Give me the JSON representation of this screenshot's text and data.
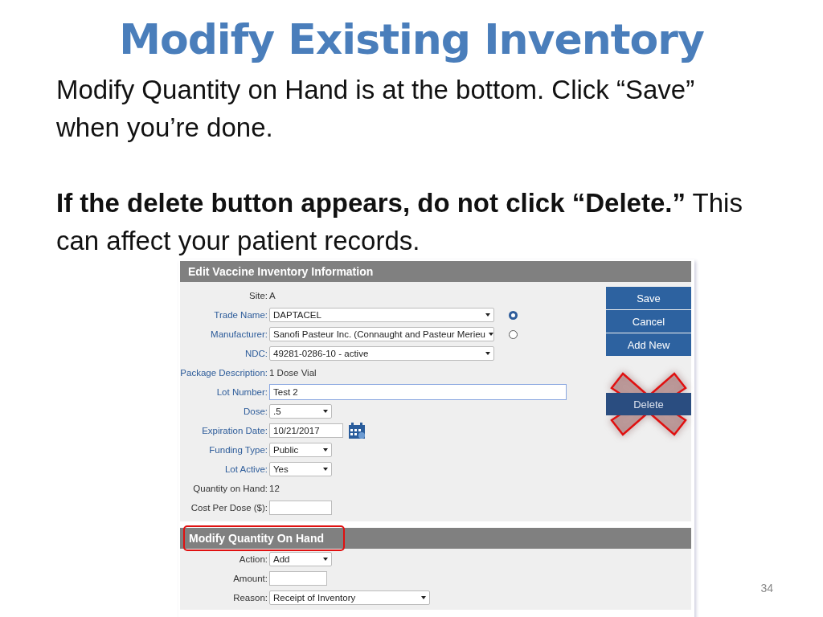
{
  "title": "Modify Existing Inventory",
  "paragraphs": [
    {
      "text": "Modify Quantity on Hand is at the bottom. Click “Save” when you’re done.",
      "bold": false
    },
    {
      "text": "**If the delete button appears, do not click “Delete.”** This can affect your patient records.",
      "bold": false
    }
  ],
  "screenshot": {
    "sections": [
      {
        "title": "Edit Vaccine Inventory Information",
        "highlighted": false,
        "rows": [
          {
            "label": "Site:",
            "kind": "text",
            "value": "A",
            "required": false
          },
          {
            "label": "Trade Name:",
            "kind": "long-select",
            "value": "DAPTACEL",
            "required": true,
            "radio": {
              "selected": true
            }
          },
          {
            "label": "Manufacturer:",
            "kind": "long-select",
            "value": "Sanofi Pasteur Inc. (Connaught and Pasteur Merieu",
            "required": true,
            "radio": {
              "selected": false
            }
          },
          {
            "label": "NDC:",
            "kind": "long-select",
            "value": "49281-0286-10 - active",
            "required": true
          },
          {
            "label": "Package Description:",
            "kind": "text",
            "value": "1 Dose Vial",
            "required": true
          },
          {
            "label": "Lot Number:",
            "kind": "long-input",
            "value": "Test 2",
            "required": true,
            "focused": true
          },
          {
            "label": "Dose:",
            "kind": "short-select",
            "value": ".5",
            "required": true
          },
          {
            "label": "Expiration Date:",
            "kind": "date",
            "value": "10/21/2017",
            "required": true,
            "focused": false
          },
          {
            "label": "Funding Type:",
            "kind": "short-select",
            "value": "Public",
            "required": true
          },
          {
            "label": "Lot Active:",
            "kind": "short-select",
            "value": "Yes",
            "required": true
          },
          {
            "label": "Quantity on Hand:",
            "kind": "text",
            "value": "12",
            "required": false
          },
          {
            "label": "Cost Per Dose ($):",
            "kind": "short-input",
            "value": "",
            "required": false,
            "focused": false
          }
        ]
      },
      {
        "title": "Modify Quantity On Hand",
        "highlighted": true,
        "rows": [
          {
            "label": "Action:",
            "kind": "short-select",
            "value": "Add",
            "required": false
          },
          {
            "label": "Amount:",
            "kind": "amount-input",
            "value": "",
            "required": false,
            "focused": false
          },
          {
            "label": "Reason:",
            "kind": "medium-select",
            "value": "Receipt of Inventory",
            "required": false
          }
        ]
      }
    ],
    "buttons": [
      {
        "label": "Save",
        "crossed_out": false
      },
      {
        "label": "Cancel",
        "crossed_out": false
      },
      {
        "label": "Add New",
        "crossed_out": false
      },
      {
        "label": "Delete",
        "crossed_out": true
      }
    ]
  },
  "page_number": "34"
}
